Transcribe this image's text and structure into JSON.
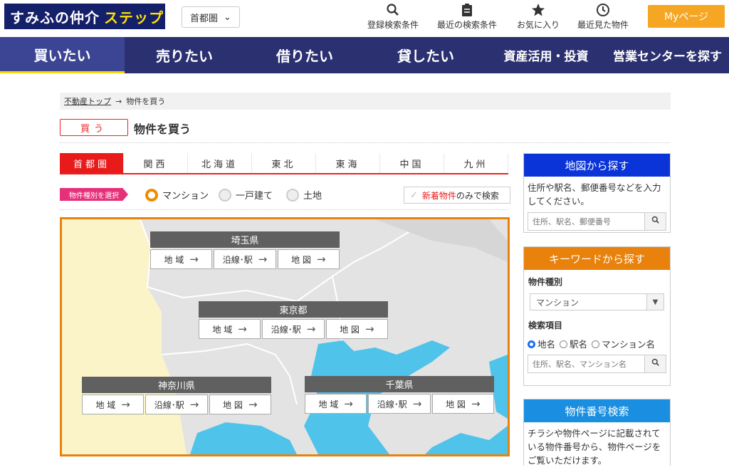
{
  "header": {
    "logo_main": "すみふの仲介",
    "logo_sub": "ステップ",
    "region_select": "首都圏",
    "links": [
      {
        "label": "登録検索条件",
        "icon": "search-icon"
      },
      {
        "label": "最近の検索条件",
        "icon": "clipboard-icon"
      },
      {
        "label": "お気に入り",
        "icon": "star-icon"
      },
      {
        "label": "最近見た物件",
        "icon": "clock-icon"
      }
    ],
    "mypage": "Myページ"
  },
  "nav": [
    "買いたい",
    "売りたい",
    "借りたい",
    "貸したい",
    "資産活用・投資",
    "営業センターを探す"
  ],
  "breadcrumb": {
    "home": "不動産トップ",
    "arrow": "→",
    "current": "物件を買う"
  },
  "buy_tag": "買う",
  "page_title": "物件を買う",
  "region_tabs": [
    "首都圏",
    "関西",
    "北海道",
    "東北",
    "東海",
    "中国",
    "九州"
  ],
  "type_label": "物件種別を選択",
  "types": [
    "マンション",
    "一戸建て",
    "土地"
  ],
  "new_only": {
    "check": "✓",
    "red": "新着物件",
    "rest": "のみで検索"
  },
  "prefectures": [
    {
      "name": "埼玉県",
      "buttons": [
        "地 域",
        "沿線･駅",
        "地 図"
      ]
    },
    {
      "name": "東京都",
      "buttons": [
        "地 域",
        "沿線･駅",
        "地 図"
      ]
    },
    {
      "name": "神奈川県",
      "buttons": [
        "地 域",
        "沿線･駅",
        "地 図"
      ]
    },
    {
      "name": "千葉県",
      "buttons": [
        "地 域",
        "沿線･駅",
        "地 図"
      ]
    }
  ],
  "sidebar": {
    "map_search": {
      "title": "地図から探す",
      "desc": "住所や駅名、郵便番号などを入力してください。",
      "placeholder": "住所、駅名、郵便番号"
    },
    "keyword_search": {
      "title": "キーワードから探す",
      "type_label": "物件種別",
      "type_value": "マンション",
      "item_label": "検索項目",
      "options": [
        "地名",
        "駅名",
        "マンション名"
      ],
      "placeholder": "住所、駅名、マンション名"
    },
    "number_search": {
      "title": "物件番号検索",
      "desc": "チラシや物件ページに記載されている物件番号から、物件ページをご覧いただけます。"
    }
  },
  "colors": {
    "navy": "#2b3070",
    "accent_red": "#e81a1a",
    "orange": "#e8820c",
    "blue": "#0a34d8",
    "sky": "#1a8ee0",
    "sea": "#4fc3ea",
    "land_yellow": "#fbf4c8"
  }
}
